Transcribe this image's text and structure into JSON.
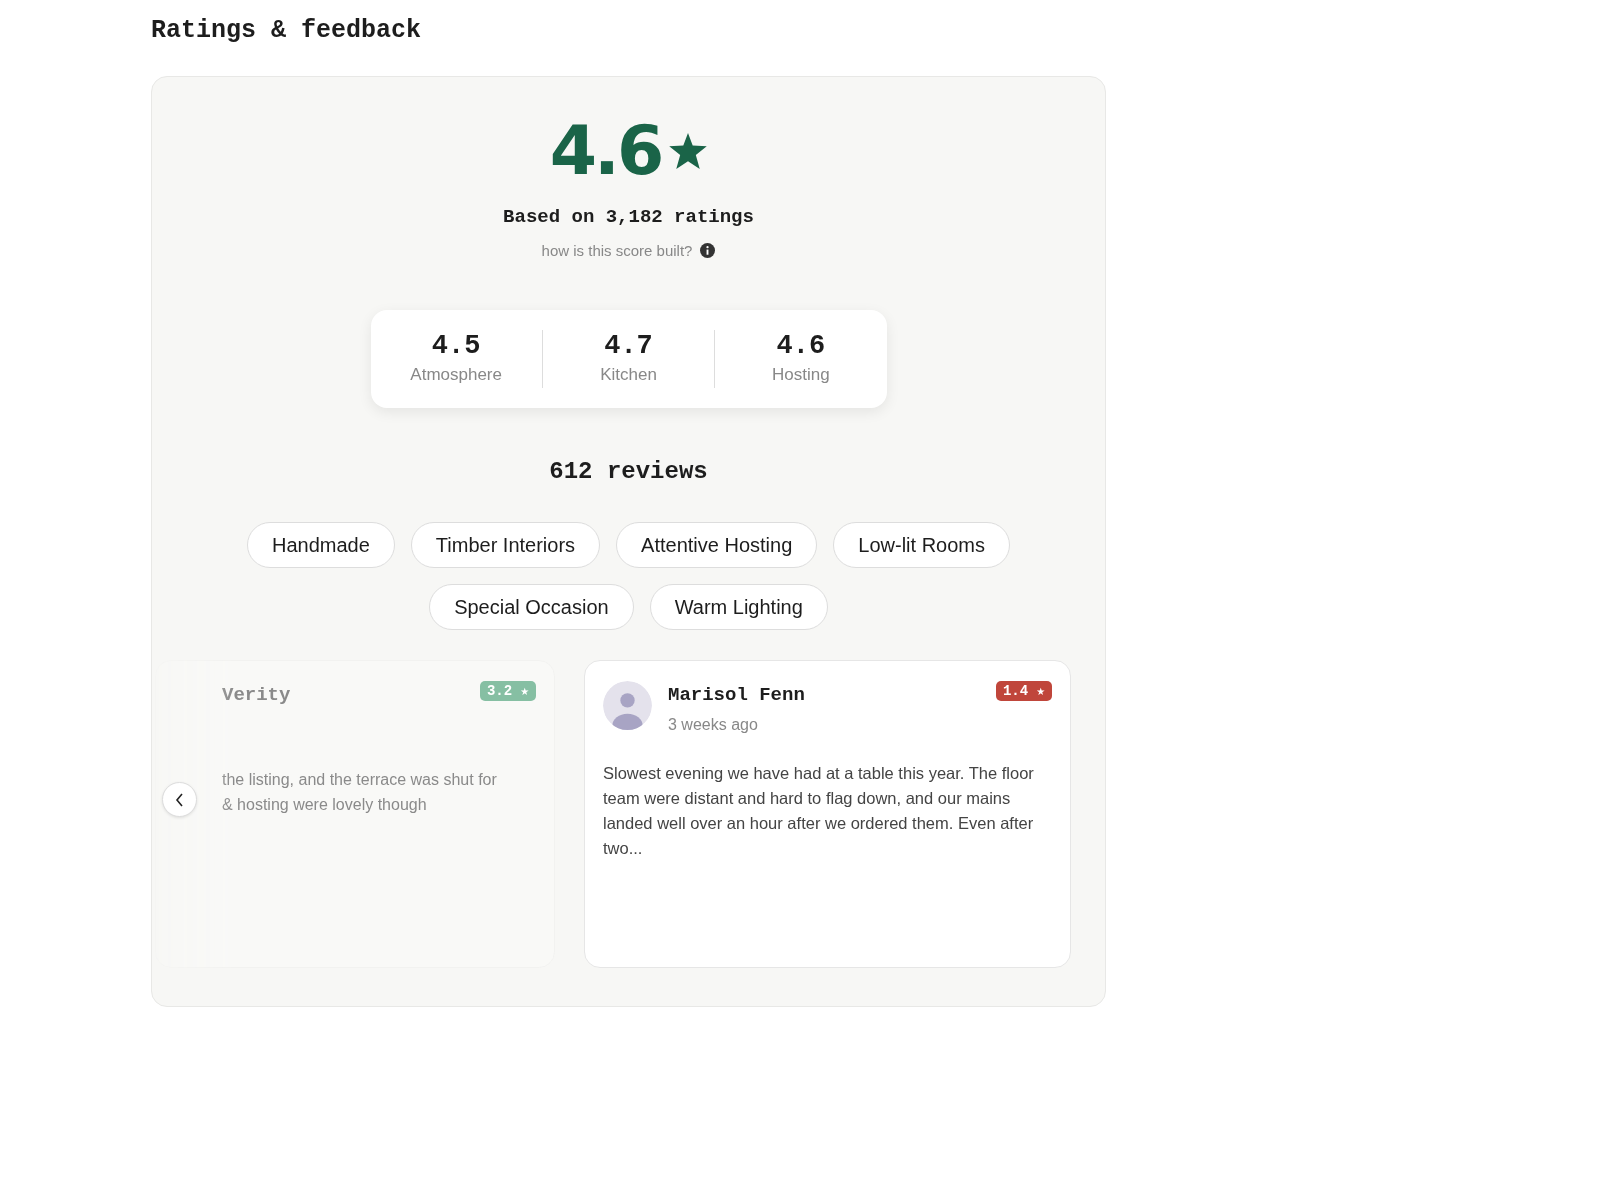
{
  "page_title": "Ratings & feedback",
  "overall": {
    "score": "4.6",
    "based_on": "Based on 3,182 ratings",
    "help_link": "how is this score built?"
  },
  "categories": [
    {
      "score": "4.5",
      "label": "Atmosphere"
    },
    {
      "score": "4.7",
      "label": "Kitchen"
    },
    {
      "score": "4.6",
      "label": "Hosting"
    }
  ],
  "reviews_count": "612 reviews",
  "tags": [
    "Handmade",
    "Timber Interiors",
    "Attentive Hosting",
    "Low-lit Rooms",
    "Special Occasion",
    "Warm Lighting"
  ],
  "reviews": [
    {
      "kind": "faded",
      "name": "Verity",
      "rating": "3.2 ★",
      "color": "#86bfa3",
      "body": "the listing, and the terrace was shut for",
      "body_2": "& hosting were lovely though"
    },
    {
      "kind": "full",
      "name": "Marisol Fenn",
      "time": "3 weeks ago",
      "rating": "1.4 ★",
      "color": "#c0463b",
      "body": "Slowest evening we have had at a table this year. The floor team were distant and hard to flag down, and our mains landed well over an hour after we ordered them. Even after two..."
    }
  ]
}
